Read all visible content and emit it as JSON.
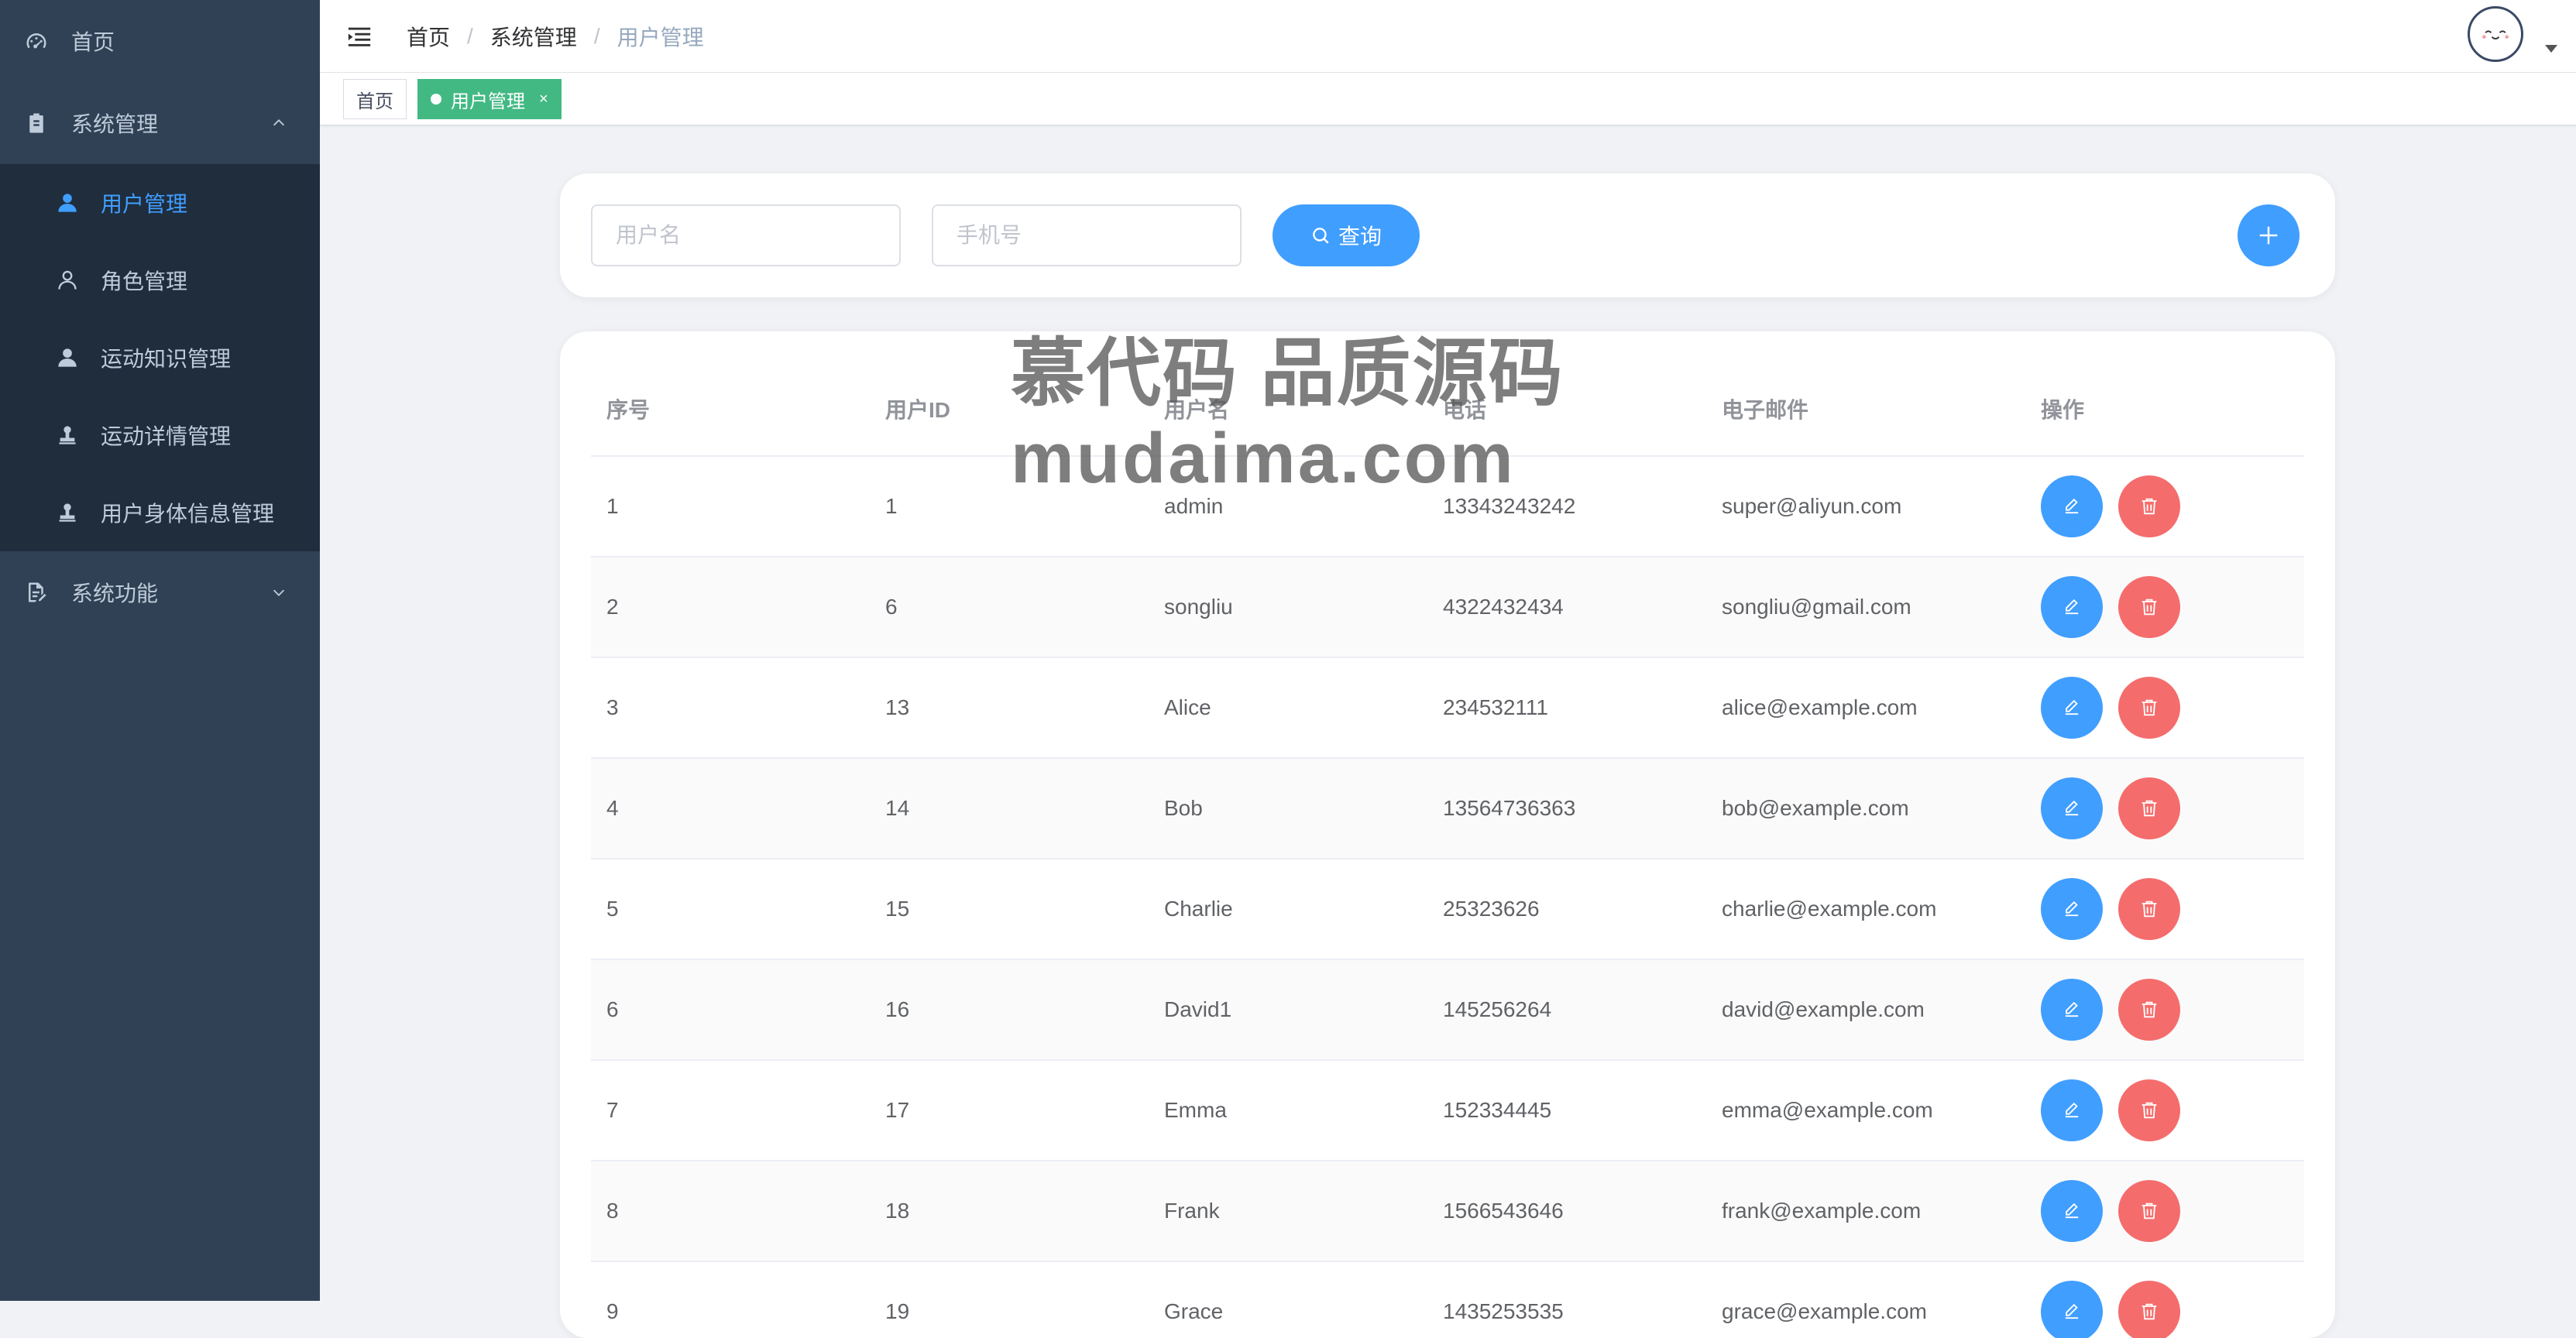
{
  "sidebar": {
    "items": [
      {
        "label": "首页",
        "icon": "dashboard-icon"
      },
      {
        "label": "系统管理",
        "icon": "clipboard-icon",
        "expanded": true,
        "children": [
          {
            "label": "用户管理",
            "icon": "user-icon",
            "active": true
          },
          {
            "label": "角色管理",
            "icon": "user-outline-icon"
          },
          {
            "label": "运动知识管理",
            "icon": "user-icon"
          },
          {
            "label": "运动详情管理",
            "icon": "stamp-icon"
          },
          {
            "label": "用户身体信息管理",
            "icon": "stamp-icon"
          }
        ]
      },
      {
        "label": "系统功能",
        "icon": "document-edit-icon",
        "expanded": false
      }
    ]
  },
  "header": {
    "breadcrumb": [
      "首页",
      "系统管理",
      "用户管理"
    ]
  },
  "tags": [
    {
      "label": "首页",
      "active": false
    },
    {
      "label": "用户管理",
      "active": true,
      "close": "×"
    }
  ],
  "search": {
    "username_placeholder": "用户名",
    "phone_placeholder": "手机号",
    "query_label": "查询"
  },
  "table": {
    "columns": [
      "序号",
      "用户ID",
      "用户名",
      "电话",
      "电子邮件",
      "操作"
    ],
    "rows": [
      [
        "1",
        "1",
        "admin",
        "13343243242",
        "super@aliyun.com"
      ],
      [
        "2",
        "6",
        "songliu",
        "4322432434",
        "songliu@gmail.com"
      ],
      [
        "3",
        "13",
        "Alice",
        "234532111",
        "alice@example.com"
      ],
      [
        "4",
        "14",
        "Bob",
        "13564736363",
        "bob@example.com"
      ],
      [
        "5",
        "15",
        "Charlie",
        "25323626",
        "charlie@example.com"
      ],
      [
        "6",
        "16",
        "David1",
        "145256264",
        "david@example.com"
      ],
      [
        "7",
        "17",
        "Emma",
        "152334445",
        "emma@example.com"
      ],
      [
        "8",
        "18",
        "Frank",
        "1566543646",
        "frank@example.com"
      ],
      [
        "9",
        "19",
        "Grace",
        "1435253535",
        "grace@example.com"
      ]
    ]
  },
  "watermark": {
    "line1": "慕代码 品质源码",
    "line2": "mudaima.com"
  },
  "colors": {
    "sidebar_bg": "#304156",
    "submenu_bg": "#1f2d3d",
    "primary": "#409eff",
    "danger": "#f56c6c",
    "tag_active": "#42b983"
  }
}
